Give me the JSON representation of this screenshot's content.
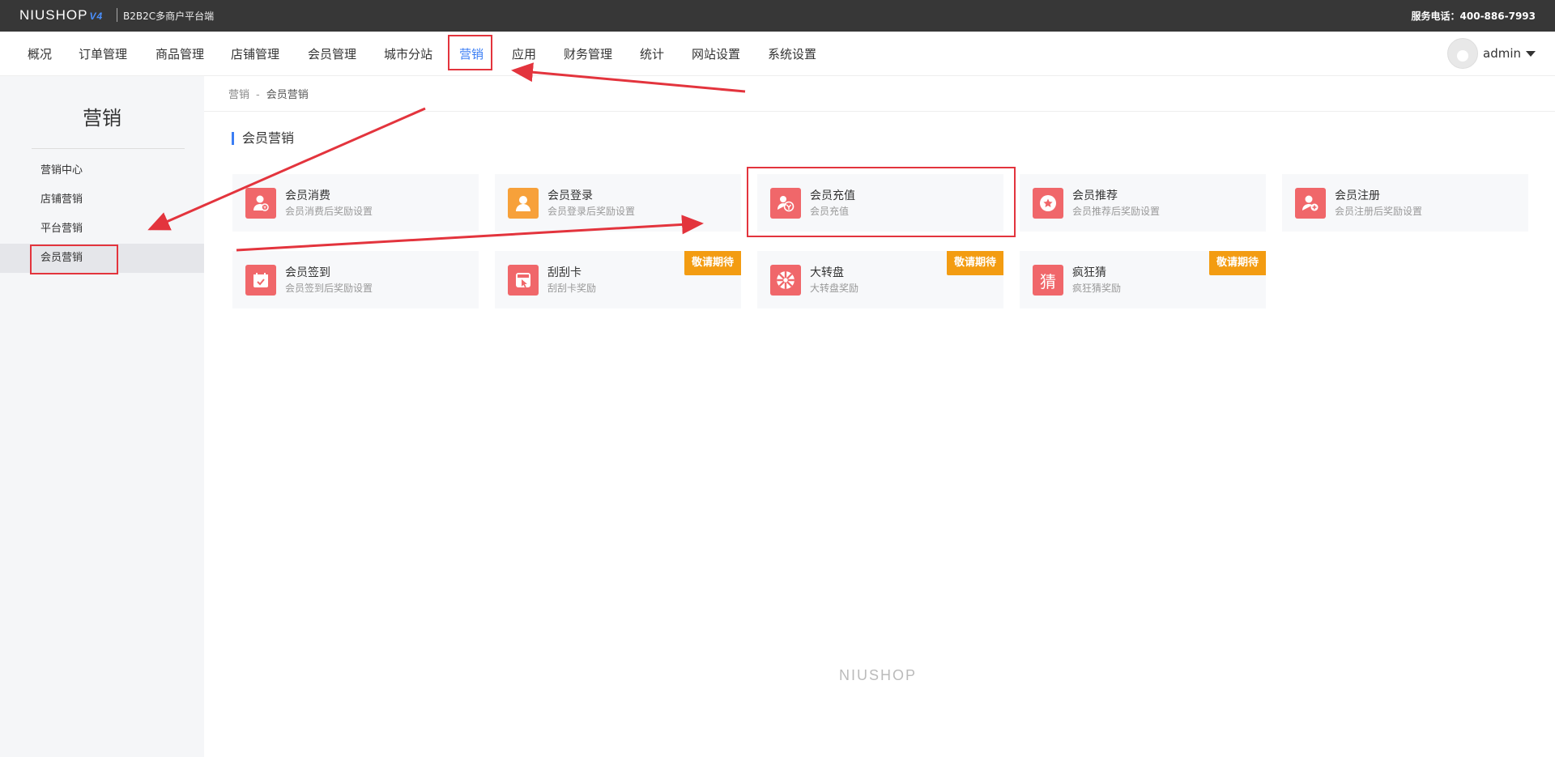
{
  "topbar": {
    "logo": "NIUSHOP",
    "logo_version": "V4",
    "subtitle": "B2B2C多商户平台端",
    "service_phone": "服务电话：400-886-7993"
  },
  "nav": {
    "items": [
      "概况",
      "订单管理",
      "商品管理",
      "店铺管理",
      "会员管理",
      "城市分站",
      "营销",
      "应用",
      "财务管理",
      "统计",
      "网站设置",
      "系统设置"
    ],
    "active": "营销",
    "user": "admin"
  },
  "sidebar": {
    "title": "营销",
    "items": [
      "营销中心",
      "店铺营销",
      "平台营销",
      "会员营销"
    ],
    "active": "会员营销"
  },
  "breadcrumb": {
    "root": "营销",
    "separator": "-",
    "current": "会员营销"
  },
  "section": {
    "title": "会员营销"
  },
  "cards": [
    {
      "name": "会员消费",
      "desc": "会员消费后奖励设置",
      "icon": "member-consume-icon",
      "color": "#f0676a",
      "tag": ""
    },
    {
      "name": "会员登录",
      "desc": "会员登录后奖励设置",
      "icon": "member-login-icon",
      "color": "#f7a13a",
      "tag": ""
    },
    {
      "name": "会员充值",
      "desc": "会员充值",
      "icon": "member-recharge-icon",
      "color": "#f0676a",
      "tag": ""
    },
    {
      "name": "会员推荐",
      "desc": "会员推荐后奖励设置",
      "icon": "member-recommend-icon",
      "color": "#f0676a",
      "tag": ""
    },
    {
      "name": "会员注册",
      "desc": "会员注册后奖励设置",
      "icon": "member-register-icon",
      "color": "#f0676a",
      "tag": ""
    },
    {
      "name": "会员签到",
      "desc": "会员签到后奖励设置",
      "icon": "member-signin-icon",
      "color": "#f0676a",
      "tag": ""
    },
    {
      "name": "刮刮卡",
      "desc": "刮刮卡奖励",
      "icon": "scratch-card-icon",
      "color": "#f0676a",
      "tag": "敬请期待"
    },
    {
      "name": "大转盘",
      "desc": "大转盘奖励",
      "icon": "big-wheel-icon",
      "color": "#f0676a",
      "tag": "敬请期待"
    },
    {
      "name": "疯狂猜",
      "desc": "疯狂猜奖励",
      "icon": "crazy-guess-icon",
      "color": "#f0676a",
      "tag": "敬请期待",
      "icon_text": "猜"
    }
  ],
  "footer": {
    "logo": "NIUSHOP"
  },
  "colors": {
    "accent": "#3b7ef4",
    "highlight_red": "#e3343d",
    "tag_orange": "#f39c12"
  }
}
